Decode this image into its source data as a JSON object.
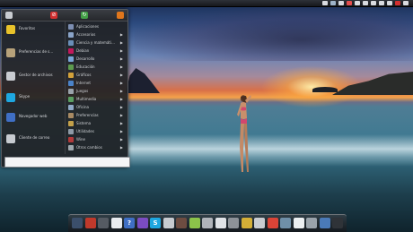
{
  "menu": {
    "favorites": [
      {
        "label": "Favoritos",
        "icon": "star-icon",
        "color": "#e8c22a"
      },
      {
        "label": "Preferencias de s…",
        "icon": "tools-icon",
        "color": "#b7a27a"
      },
      {
        "label": "Gestor de archivos",
        "icon": "file-manager-icon",
        "color": "#c9ccd1"
      },
      {
        "label": "Skype",
        "icon": "skype-icon",
        "color": "#1ea7e0"
      },
      {
        "label": "Navegador web",
        "icon": "web-browser-icon",
        "color": "#3f6fc4"
      },
      {
        "label": "Cliente de correo",
        "icon": "mail-icon",
        "color": "#c7cbd0"
      }
    ],
    "categories": [
      {
        "label": "Aplicaciones",
        "icon": "applications-icon",
        "color": "#7d8fb3",
        "has_submenu": false
      },
      {
        "label": "Accesorios",
        "icon": "accessories-icon",
        "color": "#8aa4c8",
        "has_submenu": true
      },
      {
        "label": "Ciencia y matemáti…",
        "icon": "science-icon",
        "color": "#6a8fb8",
        "has_submenu": true
      },
      {
        "label": "Debian",
        "icon": "debian-icon",
        "color": "#c2185b",
        "has_submenu": true
      },
      {
        "label": "Desarrollo",
        "icon": "development-icon",
        "color": "#7aa6d8",
        "has_submenu": true
      },
      {
        "label": "Educación",
        "icon": "education-icon",
        "color": "#5d9b4e",
        "has_submenu": true
      },
      {
        "label": "Gráficos",
        "icon": "graphics-icon",
        "color": "#d3a13a",
        "has_submenu": true
      },
      {
        "label": "Internet",
        "icon": "internet-icon",
        "color": "#4b83c9",
        "has_submenu": true
      },
      {
        "label": "Juegos",
        "icon": "games-icon",
        "color": "#9aa3ab",
        "has_submenu": true
      },
      {
        "label": "Multimedia",
        "icon": "multimedia-icon",
        "color": "#5a9e61",
        "has_submenu": true
      },
      {
        "label": "Oficina",
        "icon": "office-icon",
        "color": "#8fa9c7",
        "has_submenu": true
      },
      {
        "label": "Preferencias",
        "icon": "preferences-icon",
        "color": "#a88a63",
        "has_submenu": true
      },
      {
        "label": "Sistema",
        "icon": "system-icon",
        "color": "#c4a14a",
        "has_submenu": true
      },
      {
        "label": "Utilidades",
        "icon": "utilities-icon",
        "color": "#8e9aa6",
        "has_submenu": true
      },
      {
        "label": "Wine",
        "icon": "wine-icon",
        "color": "#b23a3a",
        "has_submenu": true
      },
      {
        "label": "Otros cambios",
        "icon": "others-icon",
        "color": "#9fa7ad",
        "has_submenu": true
      }
    ],
    "arrow_glyph": "▶",
    "search_value": ""
  },
  "header_icons": [
    {
      "name": "menu-home-icon",
      "color": "#c9ccd1",
      "glyph": ""
    },
    {
      "name": "menu-no-entry-icon",
      "color": "#d32f2f",
      "glyph": "⊘"
    },
    {
      "name": "menu-update-icon",
      "color": "#43a047",
      "glyph": "↻"
    },
    {
      "name": "menu-firefox-icon",
      "color": "#e0761c",
      "glyph": ""
    }
  ],
  "top_panel": {
    "tray": [
      {
        "name": "network-icon",
        "color": "#d9dbe0"
      },
      {
        "name": "terminal-icon",
        "color": "#9fb3c8"
      },
      {
        "name": "share-icon",
        "color": "#d9dbe0"
      },
      {
        "name": "chat-icon",
        "color": "#e34d4d"
      },
      {
        "name": "flag-icon",
        "color": "#d9dbe0"
      },
      {
        "name": "volume-icon",
        "color": "#d9dbe0"
      },
      {
        "name": "battery-icon",
        "color": "#d9dbe0"
      },
      {
        "name": "clock-icon",
        "color": "#d9dbe0"
      },
      {
        "name": "mail-tray-icon",
        "color": "#d9dbe0"
      },
      {
        "name": "block-tray-icon",
        "color": "#d32f2f"
      },
      {
        "name": "power-icon",
        "color": "#d9dbe0"
      }
    ]
  },
  "dock": [
    {
      "name": "desktop-icon",
      "color": "#3b4f6b",
      "glyph": ""
    },
    {
      "name": "applications-dock-icon",
      "color": "#c0392b",
      "glyph": ""
    },
    {
      "name": "screenshot-tool-icon",
      "color": "#555b63",
      "glyph": ""
    },
    {
      "name": "text-editor-icon",
      "color": "#e9ecef",
      "glyph": ""
    },
    {
      "name": "help-icon",
      "color": "#3f6fc4",
      "glyph": "?"
    },
    {
      "name": "chat-client-icon",
      "color": "#7b4cc2",
      "glyph": ""
    },
    {
      "name": "skype-dock-icon",
      "color": "#1ea7e0",
      "glyph": "S"
    },
    {
      "name": "image-viewer-icon",
      "color": "#c7cbd0",
      "glyph": ""
    },
    {
      "name": "photo-editor-icon",
      "color": "#6d4c41",
      "glyph": ""
    },
    {
      "name": "android-icon",
      "color": "#8bc34a",
      "glyph": ""
    },
    {
      "name": "folder-icon",
      "color": "#b0b4ba",
      "glyph": ""
    },
    {
      "name": "search-tool-icon",
      "color": "#e0e3e7",
      "glyph": ""
    },
    {
      "name": "home-folder-icon",
      "color": "#8d9298",
      "glyph": ""
    },
    {
      "name": "display-icon",
      "color": "#d4af37",
      "glyph": ""
    },
    {
      "name": "calculator-icon",
      "color": "#c9ccd1",
      "glyph": ""
    },
    {
      "name": "chrome-icon",
      "color": "#db4437",
      "glyph": ""
    },
    {
      "name": "photo-icon",
      "color": "#6f8fa8",
      "glyph": ""
    },
    {
      "name": "notes-icon",
      "color": "#eceff1",
      "glyph": ""
    },
    {
      "name": "file-icon",
      "color": "#9aa3ab",
      "glyph": ""
    },
    {
      "name": "blender-icon",
      "color": "#4a7ab8",
      "glyph": ""
    },
    {
      "name": "monitor-icon",
      "color": "#2f3338",
      "glyph": ""
    }
  ]
}
